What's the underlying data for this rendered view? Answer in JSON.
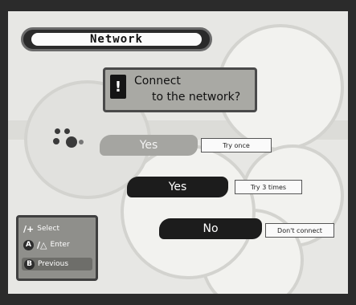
{
  "window": {
    "title": "Network"
  },
  "prompt": {
    "line1": "Connect",
    "line2": "to the network?",
    "icon": "exclamation-icon"
  },
  "options": [
    {
      "label": "Yes",
      "hint": "Try once"
    },
    {
      "label": "Yes",
      "hint": "Try 3 times"
    },
    {
      "label": "No",
      "hint": "Don't connect"
    }
  ],
  "controls": {
    "select_label": "Select",
    "enter_label": "Enter",
    "previous_label": "Previous",
    "select_glyph": "/+",
    "enter_glyph_a": "A",
    "enter_glyph_b": "/△",
    "previous_glyph": "B"
  },
  "colors": {
    "background": "#e7e7e4",
    "dark_button": "#1c1c1c",
    "highlight_button": "#a5a5a1"
  }
}
